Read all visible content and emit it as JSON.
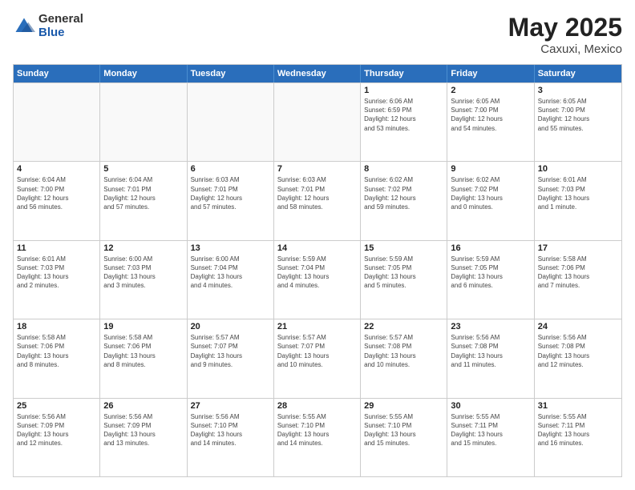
{
  "header": {
    "logo": {
      "general": "General",
      "blue": "Blue"
    },
    "title": "May 2025",
    "location": "Caxuxi, Mexico"
  },
  "weekdays": [
    "Sunday",
    "Monday",
    "Tuesday",
    "Wednesday",
    "Thursday",
    "Friday",
    "Saturday"
  ],
  "rows": [
    [
      {
        "day": "",
        "info": ""
      },
      {
        "day": "",
        "info": ""
      },
      {
        "day": "",
        "info": ""
      },
      {
        "day": "",
        "info": ""
      },
      {
        "day": "1",
        "info": "Sunrise: 6:06 AM\nSunset: 6:59 PM\nDaylight: 12 hours\nand 53 minutes."
      },
      {
        "day": "2",
        "info": "Sunrise: 6:05 AM\nSunset: 7:00 PM\nDaylight: 12 hours\nand 54 minutes."
      },
      {
        "day": "3",
        "info": "Sunrise: 6:05 AM\nSunset: 7:00 PM\nDaylight: 12 hours\nand 55 minutes."
      }
    ],
    [
      {
        "day": "4",
        "info": "Sunrise: 6:04 AM\nSunset: 7:00 PM\nDaylight: 12 hours\nand 56 minutes."
      },
      {
        "day": "5",
        "info": "Sunrise: 6:04 AM\nSunset: 7:01 PM\nDaylight: 12 hours\nand 57 minutes."
      },
      {
        "day": "6",
        "info": "Sunrise: 6:03 AM\nSunset: 7:01 PM\nDaylight: 12 hours\nand 57 minutes."
      },
      {
        "day": "7",
        "info": "Sunrise: 6:03 AM\nSunset: 7:01 PM\nDaylight: 12 hours\nand 58 minutes."
      },
      {
        "day": "8",
        "info": "Sunrise: 6:02 AM\nSunset: 7:02 PM\nDaylight: 12 hours\nand 59 minutes."
      },
      {
        "day": "9",
        "info": "Sunrise: 6:02 AM\nSunset: 7:02 PM\nDaylight: 13 hours\nand 0 minutes."
      },
      {
        "day": "10",
        "info": "Sunrise: 6:01 AM\nSunset: 7:03 PM\nDaylight: 13 hours\nand 1 minute."
      }
    ],
    [
      {
        "day": "11",
        "info": "Sunrise: 6:01 AM\nSunset: 7:03 PM\nDaylight: 13 hours\nand 2 minutes."
      },
      {
        "day": "12",
        "info": "Sunrise: 6:00 AM\nSunset: 7:03 PM\nDaylight: 13 hours\nand 3 minutes."
      },
      {
        "day": "13",
        "info": "Sunrise: 6:00 AM\nSunset: 7:04 PM\nDaylight: 13 hours\nand 4 minutes."
      },
      {
        "day": "14",
        "info": "Sunrise: 5:59 AM\nSunset: 7:04 PM\nDaylight: 13 hours\nand 4 minutes."
      },
      {
        "day": "15",
        "info": "Sunrise: 5:59 AM\nSunset: 7:05 PM\nDaylight: 13 hours\nand 5 minutes."
      },
      {
        "day": "16",
        "info": "Sunrise: 5:59 AM\nSunset: 7:05 PM\nDaylight: 13 hours\nand 6 minutes."
      },
      {
        "day": "17",
        "info": "Sunrise: 5:58 AM\nSunset: 7:06 PM\nDaylight: 13 hours\nand 7 minutes."
      }
    ],
    [
      {
        "day": "18",
        "info": "Sunrise: 5:58 AM\nSunset: 7:06 PM\nDaylight: 13 hours\nand 8 minutes."
      },
      {
        "day": "19",
        "info": "Sunrise: 5:58 AM\nSunset: 7:06 PM\nDaylight: 13 hours\nand 8 minutes."
      },
      {
        "day": "20",
        "info": "Sunrise: 5:57 AM\nSunset: 7:07 PM\nDaylight: 13 hours\nand 9 minutes."
      },
      {
        "day": "21",
        "info": "Sunrise: 5:57 AM\nSunset: 7:07 PM\nDaylight: 13 hours\nand 10 minutes."
      },
      {
        "day": "22",
        "info": "Sunrise: 5:57 AM\nSunset: 7:08 PM\nDaylight: 13 hours\nand 10 minutes."
      },
      {
        "day": "23",
        "info": "Sunrise: 5:56 AM\nSunset: 7:08 PM\nDaylight: 13 hours\nand 11 minutes."
      },
      {
        "day": "24",
        "info": "Sunrise: 5:56 AM\nSunset: 7:08 PM\nDaylight: 13 hours\nand 12 minutes."
      }
    ],
    [
      {
        "day": "25",
        "info": "Sunrise: 5:56 AM\nSunset: 7:09 PM\nDaylight: 13 hours\nand 12 minutes."
      },
      {
        "day": "26",
        "info": "Sunrise: 5:56 AM\nSunset: 7:09 PM\nDaylight: 13 hours\nand 13 minutes."
      },
      {
        "day": "27",
        "info": "Sunrise: 5:56 AM\nSunset: 7:10 PM\nDaylight: 13 hours\nand 14 minutes."
      },
      {
        "day": "28",
        "info": "Sunrise: 5:55 AM\nSunset: 7:10 PM\nDaylight: 13 hours\nand 14 minutes."
      },
      {
        "day": "29",
        "info": "Sunrise: 5:55 AM\nSunset: 7:10 PM\nDaylight: 13 hours\nand 15 minutes."
      },
      {
        "day": "30",
        "info": "Sunrise: 5:55 AM\nSunset: 7:11 PM\nDaylight: 13 hours\nand 15 minutes."
      },
      {
        "day": "31",
        "info": "Sunrise: 5:55 AM\nSunset: 7:11 PM\nDaylight: 13 hours\nand 16 minutes."
      }
    ]
  ]
}
